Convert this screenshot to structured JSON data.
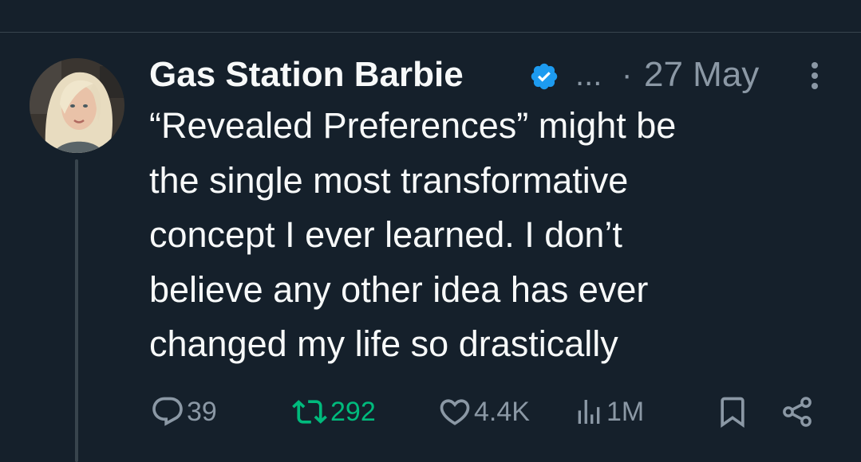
{
  "tweet": {
    "author_name": "Gas Station Barbie",
    "handle_truncated": "...",
    "separator": "·",
    "timestamp": "27 May",
    "text": "“Revealed Preferences” might be\nthe single most transformative\nconcept I ever learned. I don’t\nbelieve any other idea has ever\nchanged my life so drastically"
  },
  "actions": {
    "reply_count": "39",
    "retweet_count": "292",
    "like_count": "4.4K",
    "views_count": "1M"
  },
  "icons": {
    "verified": "verified-badge-icon",
    "more": "more-options-icon",
    "reply": "reply-icon",
    "retweet": "retweet-icon",
    "like": "heart-icon",
    "views": "views-icon",
    "bookmark": "bookmark-icon",
    "share": "share-icon"
  },
  "colors": {
    "background": "#15202b",
    "text_primary": "#f7f9f9",
    "text_secondary": "#8b98a5",
    "verified_blue": "#1d9bf0",
    "retweet_green": "#00ba7c",
    "divider": "#38444d"
  }
}
